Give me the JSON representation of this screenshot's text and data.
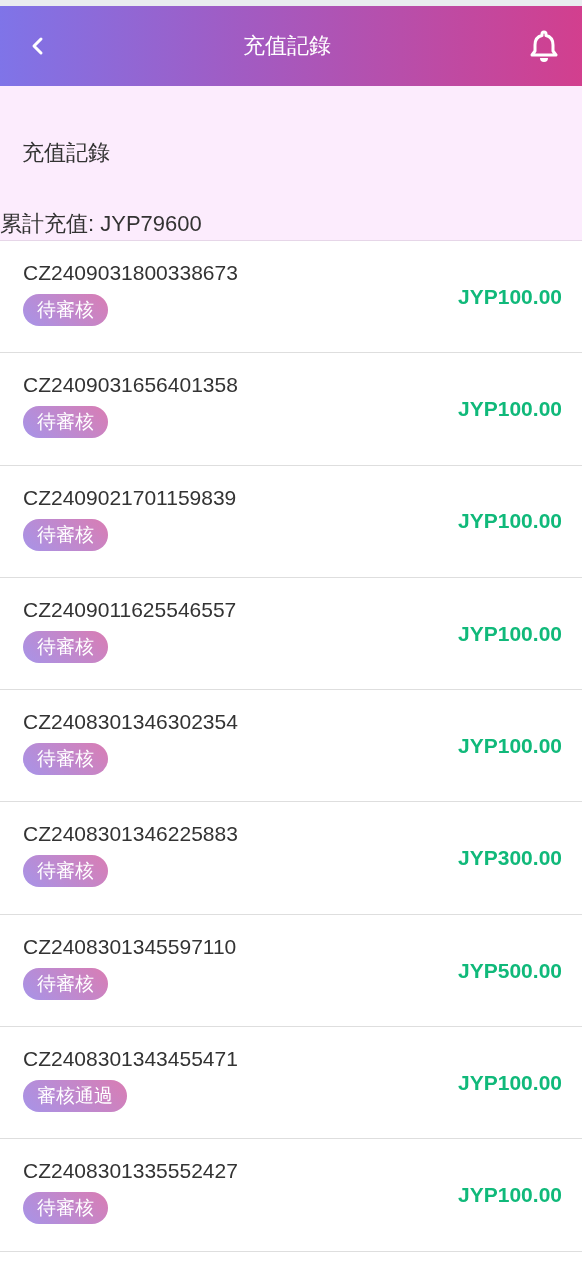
{
  "header": {
    "title": "充值記錄"
  },
  "summary": {
    "heading": "充值記錄",
    "total": "累計充值: JYP79600"
  },
  "records": [
    {
      "order_no": "CZ2409031800338673",
      "status": "待審核",
      "amount": "JYP100.00"
    },
    {
      "order_no": "CZ2409031656401358",
      "status": "待審核",
      "amount": "JYP100.00"
    },
    {
      "order_no": "CZ2409021701159839",
      "status": "待審核",
      "amount": "JYP100.00"
    },
    {
      "order_no": "CZ2409011625546557",
      "status": "待審核",
      "amount": "JYP100.00"
    },
    {
      "order_no": "CZ2408301346302354",
      "status": "待審核",
      "amount": "JYP100.00"
    },
    {
      "order_no": "CZ2408301346225883",
      "status": "待審核",
      "amount": "JYP300.00"
    },
    {
      "order_no": "CZ2408301345597110",
      "status": "待審核",
      "amount": "JYP500.00"
    },
    {
      "order_no": "CZ2408301343455471",
      "status": "審核通過",
      "amount": "JYP100.00"
    },
    {
      "order_no": "CZ2408301335552427",
      "status": "待審核",
      "amount": "JYP100.00"
    }
  ]
}
